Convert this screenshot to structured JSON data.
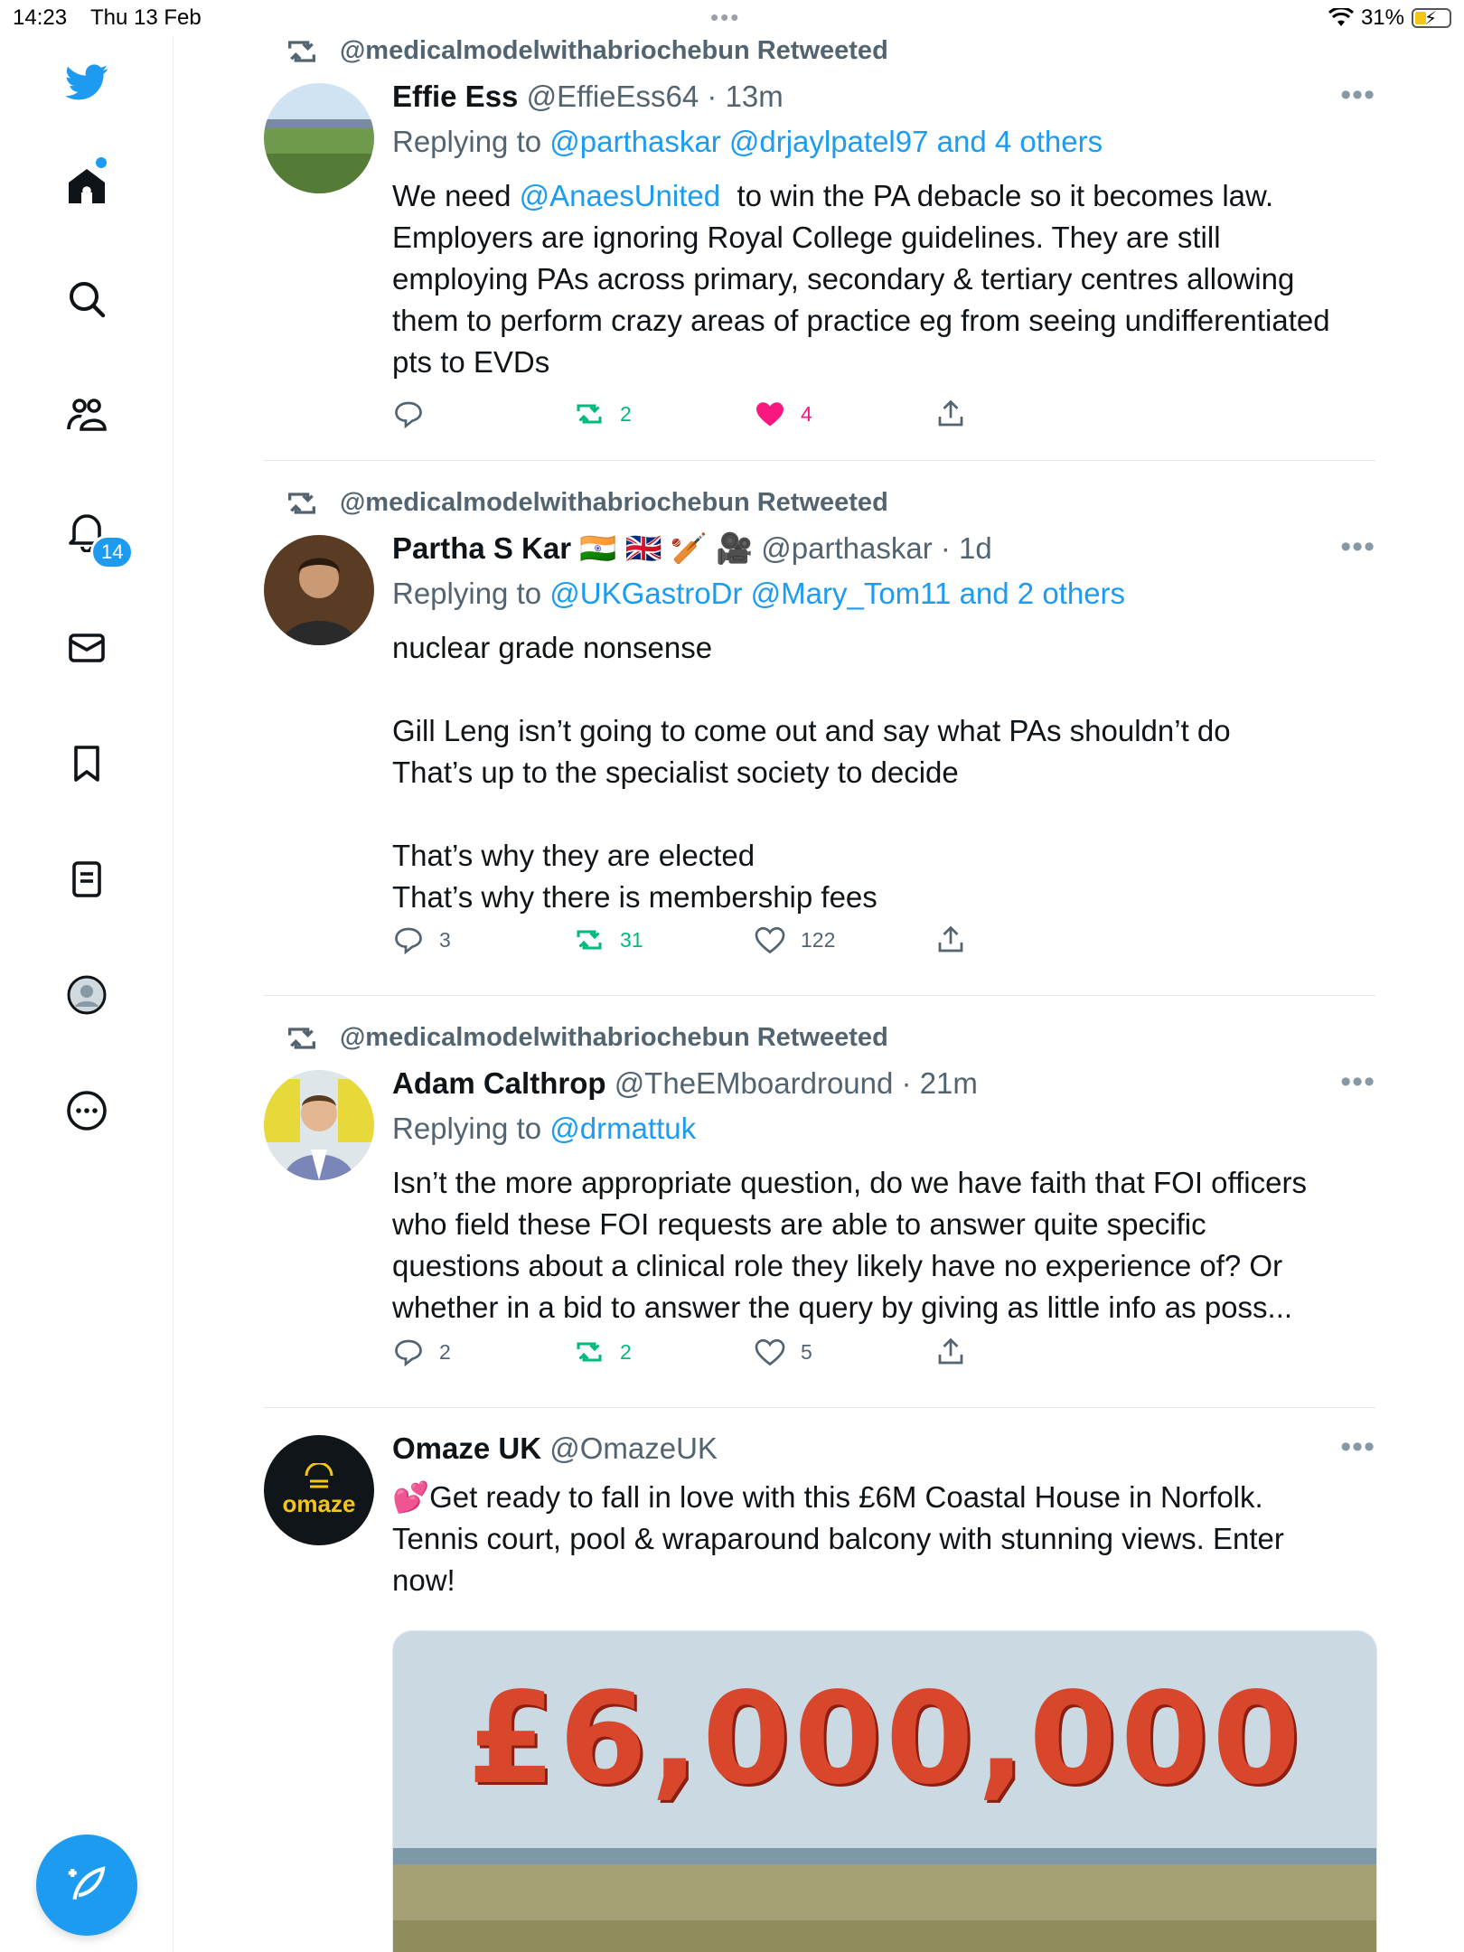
{
  "status_bar": {
    "time": "14:23",
    "date": "Thu 13 Feb",
    "battery": "31%"
  },
  "sidebar": {
    "notifications_badge": "14"
  },
  "tweets": [
    {
      "retweeted_by": "@medicalmodelwithabriochebun Retweeted",
      "name": "Effie Ess",
      "handle": "@EffieEss64",
      "time": "· 13m",
      "replying_prefix": "Replying to ",
      "replying_to": "@parthaskar @drjaylpatel97 and 4 others",
      "body_prefix": "We need ",
      "body_mention": "@AnaesUnited",
      "body_rest": "  to win the PA debacle so it becomes law.\nEmployers are ignoring Royal College guidelines. They are still\nemploying PAs across primary, secondary & tertiary centres allowing\nthem to perform crazy areas of practice eg from seeing undifferentiated\npts to EVDs",
      "replies": "",
      "retweets": "2",
      "likes": "4"
    },
    {
      "retweeted_by": "@medicalmodelwithabriochebun Retweeted",
      "name": "Partha S Kar 🇮🇳 🇬🇧 🏏 🎥",
      "handle": "@parthaskar",
      "time": "· 1d",
      "replying_prefix": "Replying to ",
      "replying_to": "@UKGastroDr @Mary_Tom11 and 2 others",
      "body": "nuclear grade nonsense\n\nGill Leng isn’t going to come out and say what PAs shouldn’t do\nThat’s up to the specialist society to decide\n\nThat’s why they are elected\nThat’s why there is membership fees",
      "replies": "3",
      "retweets": "31",
      "likes": "122"
    },
    {
      "retweeted_by": "@medicalmodelwithabriochebun Retweeted",
      "name": "Adam Calthrop",
      "handle": "@TheEMboardround",
      "time": "· 21m",
      "replying_prefix": "Replying to ",
      "replying_to": "@drmattuk",
      "body": "Isn’t the more appropriate question, do we have faith that FOI officers\nwho field these FOI requests are able to answer quite specific\nquestions about a clinical role they likely have no experience of? Or\nwhether in a bid to answer the query by giving as little info as poss...",
      "replies": "2",
      "retweets": "2",
      "likes": "5"
    },
    {
      "name": "Omaze UK",
      "handle": "@OmazeUK",
      "avatar_text": "omaze",
      "body": "💕Get ready to fall in love with this £6M Coastal House in Norfolk.\nTennis court, pool & wraparound balcony with stunning views. Enter\nnow!",
      "media_text": "£6,000,000"
    }
  ],
  "colors": {
    "accent": "#1d9bf0",
    "retweet": "#00ba7c",
    "like": "#f91880",
    "muted": "#536471"
  }
}
